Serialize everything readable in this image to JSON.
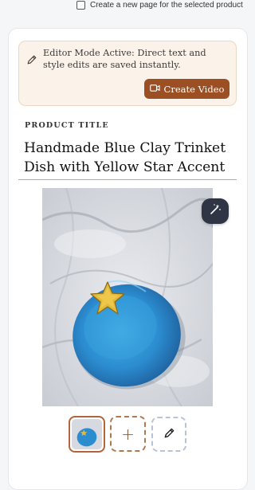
{
  "topbar": {
    "checkbox_label": "Create a new page for the selected product",
    "checked": false
  },
  "editor_banner": {
    "icon": "pencil-icon",
    "message": "Editor Mode Active: Direct text and style edits are saved instantly.",
    "video_button_icon": "video-camera-icon",
    "video_button_label": "Create Video"
  },
  "product": {
    "title_label": "PRODUCT TITLE",
    "title": "Handmade Blue Clay Trinket Dish with Yellow Star Accent"
  },
  "media": {
    "magic_button_icon": "magic-wand-icon",
    "add_button_label": "+",
    "edit_button_icon": "pencil-icon"
  },
  "colors": {
    "accent": "#9b4f23",
    "banner_bg": "#fbf3ea",
    "magic_button_bg": "#2f3544",
    "title_underline": "#d2a27c"
  }
}
